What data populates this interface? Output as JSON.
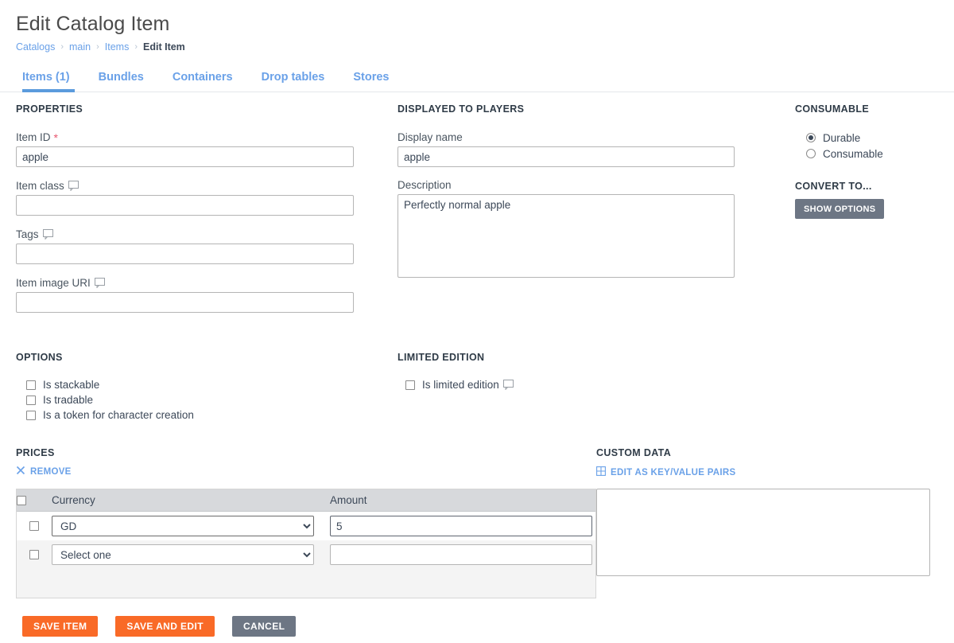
{
  "header": {
    "title": "Edit Catalog Item",
    "breadcrumb": [
      {
        "label": "Catalogs",
        "type": "link"
      },
      {
        "label": "main",
        "type": "link"
      },
      {
        "label": "Items",
        "type": "link"
      },
      {
        "label": "Edit Item",
        "type": "current"
      }
    ],
    "separator": "›"
  },
  "tabs": [
    {
      "label": "Items (1)",
      "active": true
    },
    {
      "label": "Bundles",
      "active": false
    },
    {
      "label": "Containers",
      "active": false
    },
    {
      "label": "Drop tables",
      "active": false
    },
    {
      "label": "Stores",
      "active": false
    }
  ],
  "properties": {
    "section_title": "PROPERTIES",
    "item_id": {
      "label": "Item ID",
      "required_marker": "*",
      "value": "apple",
      "placeholder": ""
    },
    "item_class": {
      "label": "Item class",
      "value": "",
      "placeholder": "",
      "has_tooltip": true
    },
    "tags": {
      "label": "Tags",
      "value": "",
      "placeholder": "",
      "has_tooltip": true
    },
    "item_image_uri": {
      "label": "Item image URI",
      "value": "",
      "placeholder": "",
      "has_tooltip": true
    }
  },
  "displayed_to_players": {
    "section_title": "DISPLAYED TO PLAYERS",
    "display_name": {
      "label": "Display name",
      "value": "apple",
      "placeholder": ""
    },
    "description": {
      "label": "Description",
      "value": "Perfectly normal apple",
      "placeholder": ""
    }
  },
  "consumable": {
    "section_title": "CONSUMABLE",
    "options": [
      {
        "label": "Durable",
        "selected": true
      },
      {
        "label": "Consumable",
        "selected": false
      }
    ]
  },
  "convert_to": {
    "section_title": "CONVERT TO...",
    "show_options_label": "SHOW OPTIONS"
  },
  "options": {
    "section_title": "OPTIONS",
    "items": [
      {
        "label": "Is stackable",
        "checked": false
      },
      {
        "label": "Is tradable",
        "checked": false
      },
      {
        "label": "Is a token for character creation",
        "checked": false
      }
    ]
  },
  "limited_edition": {
    "section_title": "LIMITED EDITION",
    "items": [
      {
        "label": "Is limited edition",
        "checked": false,
        "has_tooltip": true
      }
    ]
  },
  "prices": {
    "section_title": "PRICES",
    "remove_label": "REMOVE",
    "remove_icon": "close-x-icon",
    "columns": [
      "Currency",
      "Amount"
    ],
    "rows": [
      {
        "selected": false,
        "currency": "GD",
        "amount": "5",
        "focused": true
      },
      {
        "selected": false,
        "currency": "Select one",
        "amount": "",
        "focused": false
      }
    ],
    "currency_options": [
      "Select one",
      "GD"
    ]
  },
  "custom_data": {
    "section_title": "CUSTOM DATA",
    "edit_link_label": "EDIT AS KEY/VALUE PAIRS",
    "edit_link_icon": "grid-table-icon",
    "value": "",
    "placeholder": ""
  },
  "footer": {
    "buttons": [
      {
        "label": "SAVE ITEM",
        "style": "orange"
      },
      {
        "label": "SAVE AND EDIT",
        "style": "orange"
      },
      {
        "label": "CANCEL",
        "style": "gray"
      }
    ]
  },
  "colors": {
    "accent_orange": "#f96a27",
    "link_blue": "#6aa1e8",
    "tab_underline": "#5b9bdd",
    "gray_button": "#6d7684",
    "required_star": "#e8566f",
    "table_header": "#d7d9dc",
    "row_stripe": "#f4f4f4"
  }
}
